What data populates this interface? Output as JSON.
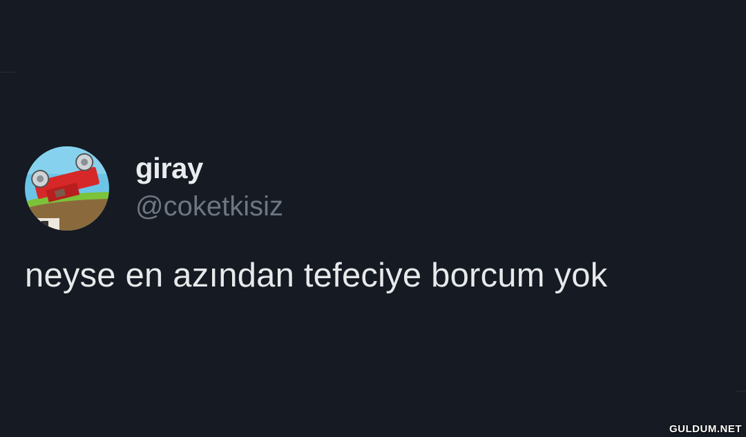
{
  "theme": {
    "background": "#151a23",
    "primary_text": "#e7e9ea",
    "secondary_text": "#6e7681"
  },
  "tweet": {
    "avatar_icon": "red-car-flipped-avatar",
    "display_name": "giray",
    "handle": "@coketkisiz",
    "text": "neyse en azından tefeciye borcum yok"
  },
  "watermark": {
    "text": "GULDUM.NET"
  }
}
